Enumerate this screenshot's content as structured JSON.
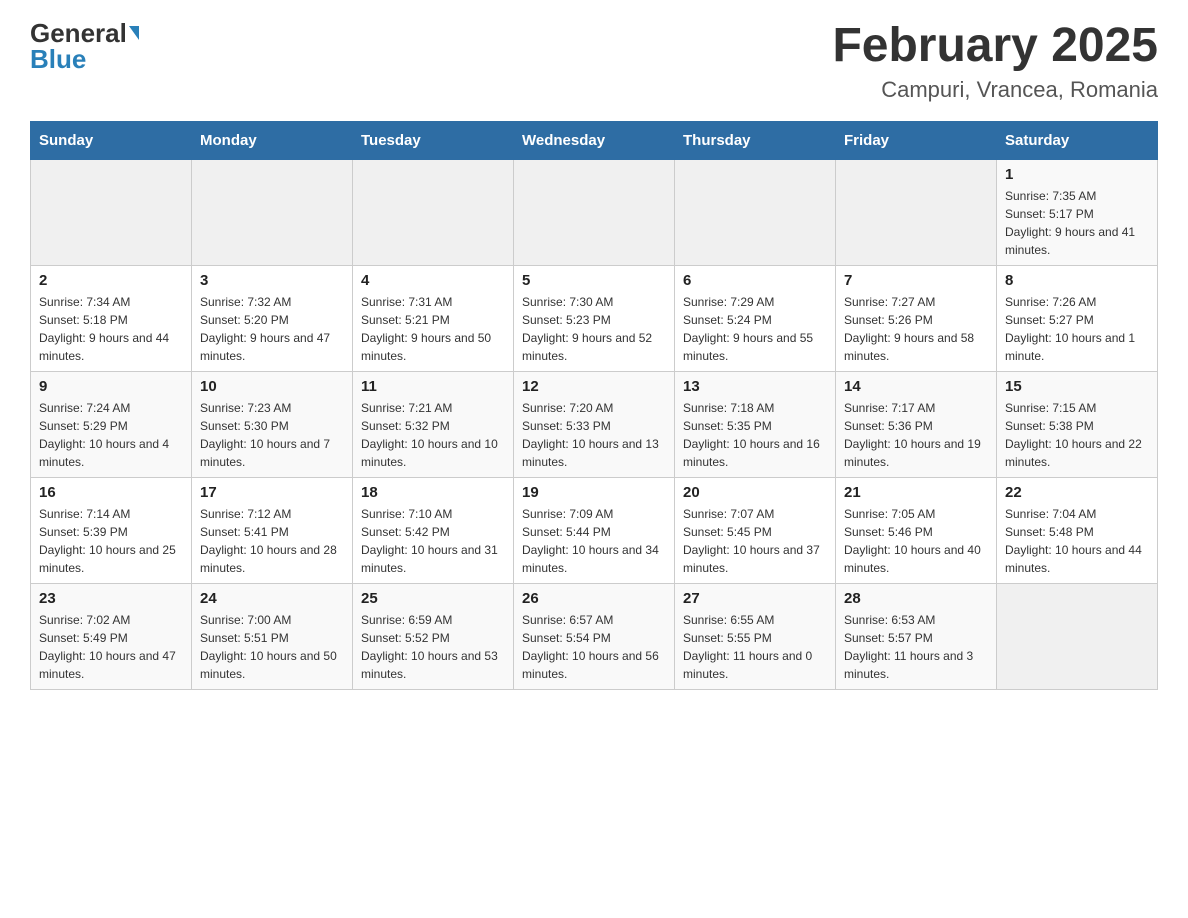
{
  "header": {
    "logo_general": "General",
    "logo_blue": "Blue",
    "title": "February 2025",
    "subtitle": "Campuri, Vrancea, Romania"
  },
  "weekdays": [
    "Sunday",
    "Monday",
    "Tuesday",
    "Wednesday",
    "Thursday",
    "Friday",
    "Saturday"
  ],
  "weeks": [
    [
      {
        "day": "",
        "info": ""
      },
      {
        "day": "",
        "info": ""
      },
      {
        "day": "",
        "info": ""
      },
      {
        "day": "",
        "info": ""
      },
      {
        "day": "",
        "info": ""
      },
      {
        "day": "",
        "info": ""
      },
      {
        "day": "1",
        "info": "Sunrise: 7:35 AM\nSunset: 5:17 PM\nDaylight: 9 hours and 41 minutes."
      }
    ],
    [
      {
        "day": "2",
        "info": "Sunrise: 7:34 AM\nSunset: 5:18 PM\nDaylight: 9 hours and 44 minutes."
      },
      {
        "day": "3",
        "info": "Sunrise: 7:32 AM\nSunset: 5:20 PM\nDaylight: 9 hours and 47 minutes."
      },
      {
        "day": "4",
        "info": "Sunrise: 7:31 AM\nSunset: 5:21 PM\nDaylight: 9 hours and 50 minutes."
      },
      {
        "day": "5",
        "info": "Sunrise: 7:30 AM\nSunset: 5:23 PM\nDaylight: 9 hours and 52 minutes."
      },
      {
        "day": "6",
        "info": "Sunrise: 7:29 AM\nSunset: 5:24 PM\nDaylight: 9 hours and 55 minutes."
      },
      {
        "day": "7",
        "info": "Sunrise: 7:27 AM\nSunset: 5:26 PM\nDaylight: 9 hours and 58 minutes."
      },
      {
        "day": "8",
        "info": "Sunrise: 7:26 AM\nSunset: 5:27 PM\nDaylight: 10 hours and 1 minute."
      }
    ],
    [
      {
        "day": "9",
        "info": "Sunrise: 7:24 AM\nSunset: 5:29 PM\nDaylight: 10 hours and 4 minutes."
      },
      {
        "day": "10",
        "info": "Sunrise: 7:23 AM\nSunset: 5:30 PM\nDaylight: 10 hours and 7 minutes."
      },
      {
        "day": "11",
        "info": "Sunrise: 7:21 AM\nSunset: 5:32 PM\nDaylight: 10 hours and 10 minutes."
      },
      {
        "day": "12",
        "info": "Sunrise: 7:20 AM\nSunset: 5:33 PM\nDaylight: 10 hours and 13 minutes."
      },
      {
        "day": "13",
        "info": "Sunrise: 7:18 AM\nSunset: 5:35 PM\nDaylight: 10 hours and 16 minutes."
      },
      {
        "day": "14",
        "info": "Sunrise: 7:17 AM\nSunset: 5:36 PM\nDaylight: 10 hours and 19 minutes."
      },
      {
        "day": "15",
        "info": "Sunrise: 7:15 AM\nSunset: 5:38 PM\nDaylight: 10 hours and 22 minutes."
      }
    ],
    [
      {
        "day": "16",
        "info": "Sunrise: 7:14 AM\nSunset: 5:39 PM\nDaylight: 10 hours and 25 minutes."
      },
      {
        "day": "17",
        "info": "Sunrise: 7:12 AM\nSunset: 5:41 PM\nDaylight: 10 hours and 28 minutes."
      },
      {
        "day": "18",
        "info": "Sunrise: 7:10 AM\nSunset: 5:42 PM\nDaylight: 10 hours and 31 minutes."
      },
      {
        "day": "19",
        "info": "Sunrise: 7:09 AM\nSunset: 5:44 PM\nDaylight: 10 hours and 34 minutes."
      },
      {
        "day": "20",
        "info": "Sunrise: 7:07 AM\nSunset: 5:45 PM\nDaylight: 10 hours and 37 minutes."
      },
      {
        "day": "21",
        "info": "Sunrise: 7:05 AM\nSunset: 5:46 PM\nDaylight: 10 hours and 40 minutes."
      },
      {
        "day": "22",
        "info": "Sunrise: 7:04 AM\nSunset: 5:48 PM\nDaylight: 10 hours and 44 minutes."
      }
    ],
    [
      {
        "day": "23",
        "info": "Sunrise: 7:02 AM\nSunset: 5:49 PM\nDaylight: 10 hours and 47 minutes."
      },
      {
        "day": "24",
        "info": "Sunrise: 7:00 AM\nSunset: 5:51 PM\nDaylight: 10 hours and 50 minutes."
      },
      {
        "day": "25",
        "info": "Sunrise: 6:59 AM\nSunset: 5:52 PM\nDaylight: 10 hours and 53 minutes."
      },
      {
        "day": "26",
        "info": "Sunrise: 6:57 AM\nSunset: 5:54 PM\nDaylight: 10 hours and 56 minutes."
      },
      {
        "day": "27",
        "info": "Sunrise: 6:55 AM\nSunset: 5:55 PM\nDaylight: 11 hours and 0 minutes."
      },
      {
        "day": "28",
        "info": "Sunrise: 6:53 AM\nSunset: 5:57 PM\nDaylight: 11 hours and 3 minutes."
      },
      {
        "day": "",
        "info": ""
      }
    ]
  ]
}
